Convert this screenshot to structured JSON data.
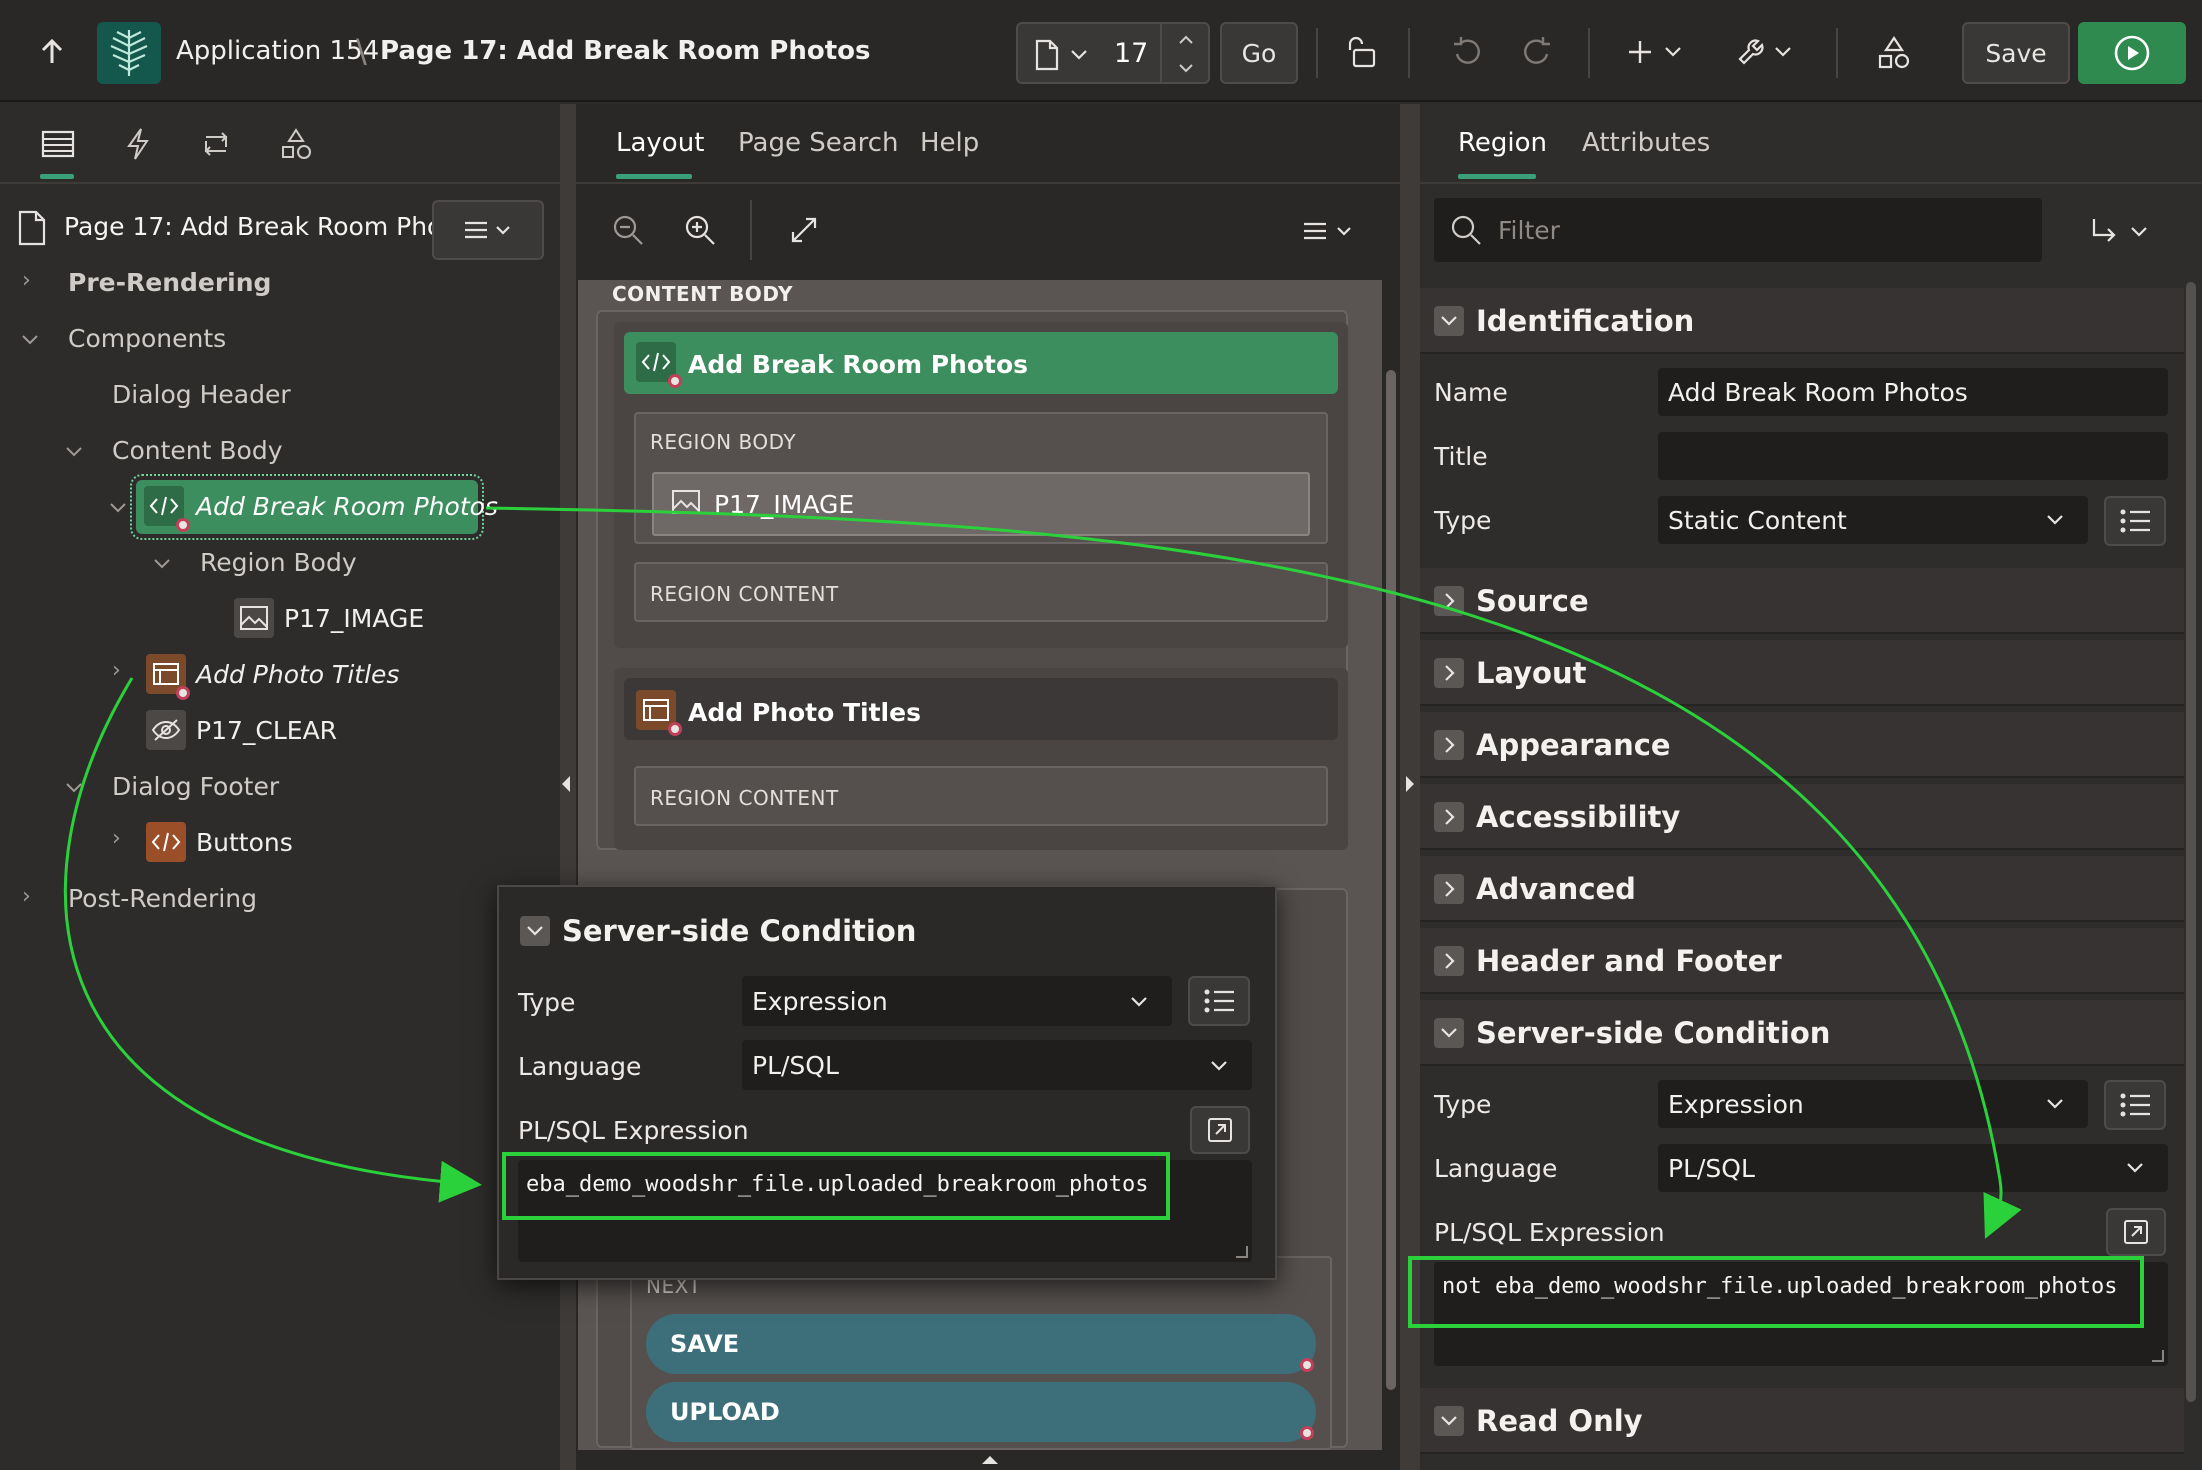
{
  "topbar": {
    "app_label": "Application 154",
    "page_label": "Page 17: Add Break Room Photos",
    "page_number": "17",
    "go_label": "Go",
    "save_label": "Save"
  },
  "left": {
    "page_title": "Page 17: Add Break Room Photos",
    "tree": {
      "pre_rendering": "Pre-Rendering",
      "components": "Components",
      "dialog_header": "Dialog Header",
      "content_body": "Content Body",
      "add_break_room_photos": "Add Break Room Photos",
      "region_body": "Region Body",
      "p17_image": "P17_IMAGE",
      "add_photo_titles": "Add Photo Titles",
      "p17_clear": "P17_CLEAR",
      "dialog_footer": "Dialog Footer",
      "buttons": "Buttons",
      "post_rendering": "Post-Rendering"
    }
  },
  "middle": {
    "tabs": [
      "Layout",
      "Page Search",
      "Help"
    ],
    "content_body": "CONTENT BODY",
    "region1_title": "Add Break Room Photos",
    "region_body": "REGION BODY",
    "item": "P17_IMAGE",
    "region_content": "REGION CONTENT",
    "region2_title": "Add Photo Titles",
    "region_content2": "REGION CONTENT",
    "next_label": "NEXT",
    "save_btn": "SAVE",
    "upload_btn": "UPLOAD"
  },
  "popup": {
    "title": "Server-side Condition",
    "type_label": "Type",
    "type_value": "Expression",
    "language_label": "Language",
    "language_value": "PL/SQL",
    "expr_label": "PL/SQL Expression",
    "expr_value": "eba_demo_woodshr_file.uploaded_breakroom_photos"
  },
  "right": {
    "tabs": [
      "Region",
      "Attributes"
    ],
    "filter_placeholder": "Filter",
    "identification": "Identification",
    "name_label": "Name",
    "name_value": "Add Break Room Photos",
    "title_label": "Title",
    "title_value": "",
    "type_label": "Type",
    "type_value": "Static Content",
    "sections": [
      "Source",
      "Layout",
      "Appearance",
      "Accessibility",
      "Advanced",
      "Header and Footer"
    ],
    "ssc_title": "Server-side Condition",
    "ssc_type_label": "Type",
    "ssc_type_value": "Expression",
    "ssc_language_label": "Language",
    "ssc_language_value": "PL/SQL",
    "ssc_expr_label": "PL/SQL Expression",
    "ssc_expr_value": "not eba_demo_woodshr_file.uploaded_breakroom_photos",
    "read_only": "Read Only"
  },
  "colors": {
    "accent_green": "#3d8e5e",
    "annotation_green": "#2bd13a",
    "button_teal": "#3d6f7a",
    "run_button": "#2e8a4f"
  }
}
